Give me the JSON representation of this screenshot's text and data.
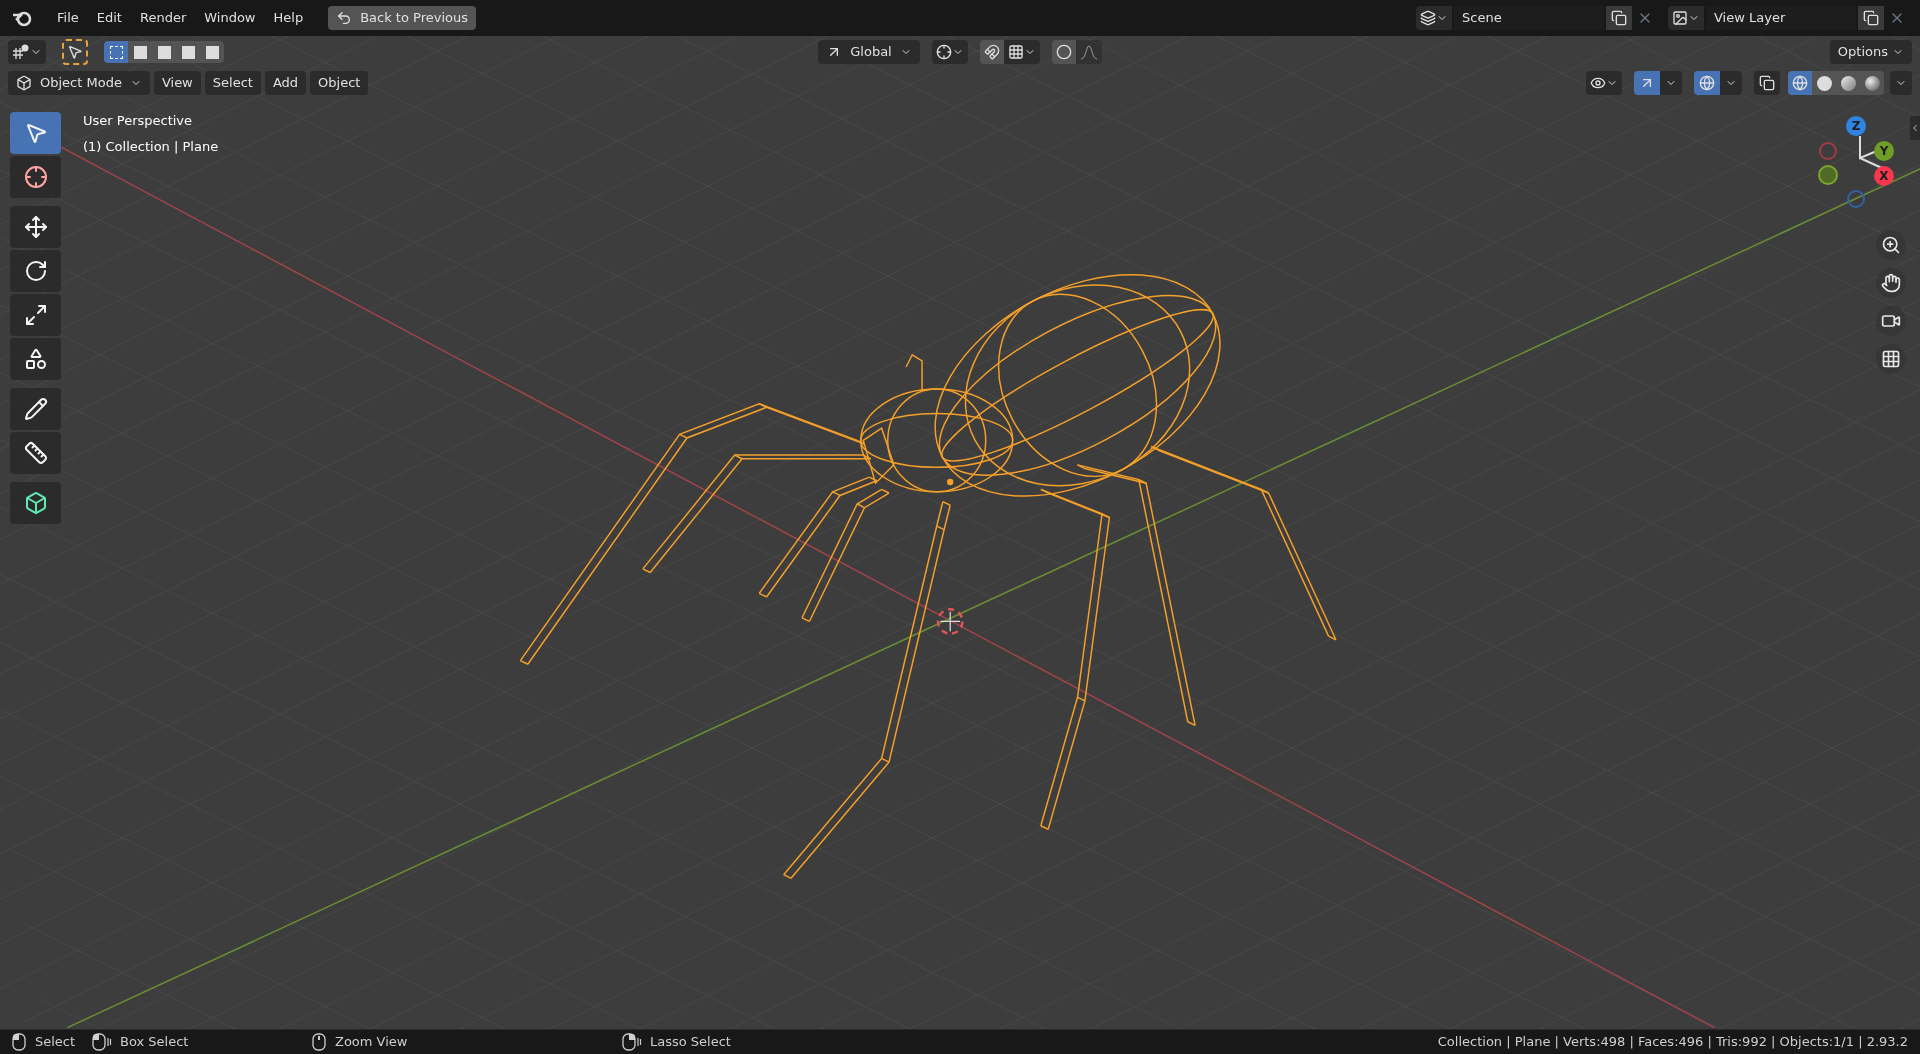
{
  "menu_bar": {
    "menus": [
      "File",
      "Edit",
      "Render",
      "Window",
      "Help"
    ],
    "back_button": "Back to Previous",
    "scene": "Scene",
    "view_layer": "View Layer"
  },
  "tool_header": {
    "select_modes": [
      {
        "selected": true
      },
      {
        "selected": false
      },
      {
        "selected": false
      },
      {
        "selected": false
      },
      {
        "selected": false
      }
    ],
    "orientation": "Global",
    "snap": {
      "on": false
    },
    "proportional_editing": {
      "on": false
    },
    "options": "Options"
  },
  "view_header": {
    "mode": "Object Mode",
    "menus": [
      "View",
      "Select",
      "Add",
      "Object"
    ],
    "gizmos": {
      "on": true
    },
    "overlays": {
      "on": true
    },
    "xray": {
      "on": false
    },
    "shading_modes": [
      {
        "selected": true
      },
      {
        "selected": false
      },
      {
        "selected": false
      },
      {
        "selected": false
      }
    ]
  },
  "toolbar": [
    {
      "kind": "select",
      "selected": true
    },
    {
      "kind": "cursor",
      "selected": false
    },
    {
      "kind": "move",
      "selected": false
    },
    {
      "kind": "rotate",
      "selected": false
    },
    {
      "kind": "scale",
      "selected": false
    },
    {
      "kind": "transform",
      "selected": false
    },
    {
      "kind": "annotate",
      "selected": false
    },
    {
      "kind": "measure",
      "selected": false
    },
    {
      "kind": "add_cube",
      "selected": false
    }
  ],
  "viewport": {
    "view_name": "User Perspective",
    "collection_info": "(1) Collection | Plane"
  },
  "gizmo": {
    "axes": [
      {
        "label": "Z",
        "color": "#2f83e3"
      },
      {
        "label": "Y",
        "color": "#6e9e28"
      },
      {
        "label": "X",
        "color": "#f5374f"
      }
    ]
  },
  "status_bar": {
    "hints": [
      {
        "kind": "mouse_left",
        "label": "Select"
      },
      {
        "kind": "mouse_left_drag",
        "label": "Box Select"
      },
      {
        "kind": "mouse_middle",
        "label": "Zoom View"
      },
      {
        "kind": "mouse_right_drag",
        "label": "Lasso Select"
      }
    ],
    "stats": "Collection | Plane | Verts:498 | Faces:496 | Tris:992 | Objects:1/1 | 2.93.2"
  }
}
